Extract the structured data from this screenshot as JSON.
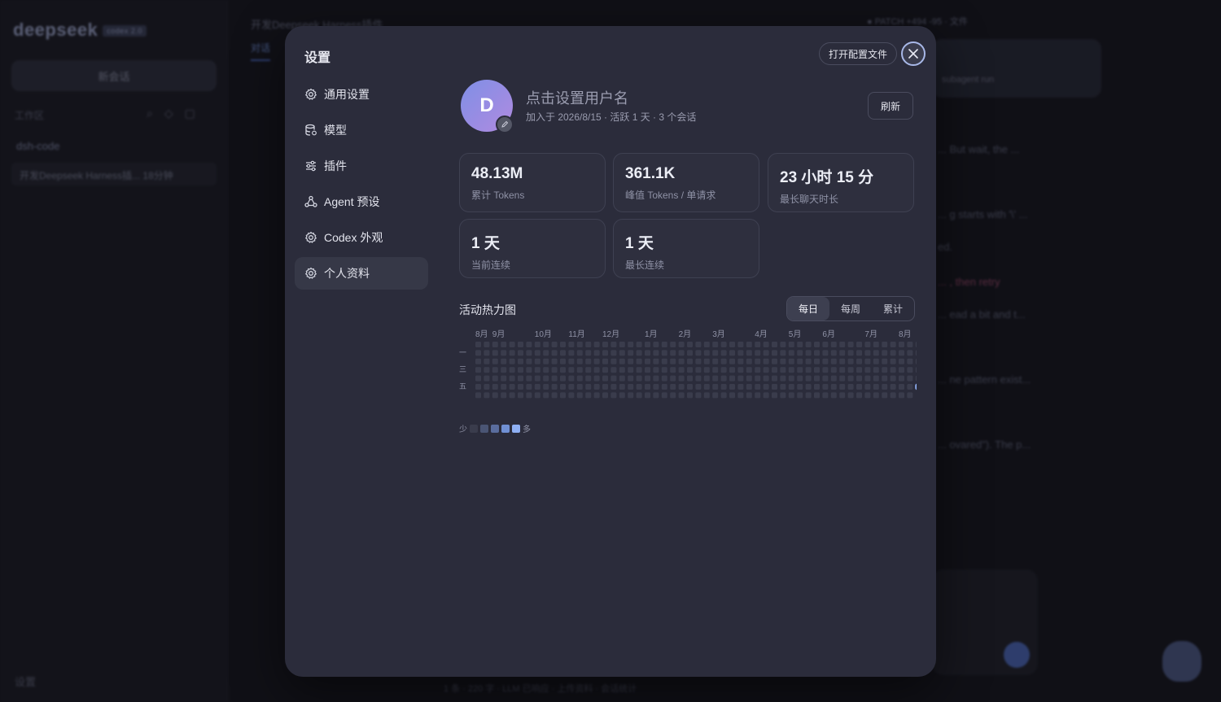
{
  "background": {
    "logo": "deepseek",
    "version": "codex 2.0",
    "new_chat": "新会话",
    "workspace_label": "工作区",
    "folder": "dsh-code",
    "session": "开发Deepseek Harness插... 18分钟",
    "settings": "设置",
    "top_title": "开发Deepseek Harness插件",
    "top_tab": "对话",
    "status": "● PATCH +494 -95 · 文件",
    "card_text": "subagent run",
    "lines": [
      "... But wait, the ...",
      "... g starts with '\\' ...",
      "ed.",
      "... , then retry",
      "... ead a bit and t...",
      "... ne pattern exist...",
      "... ovared\"). The p..."
    ],
    "bottom": "1 条 · 220 字 · LLM 已响应 · 上传资料 · 会话统计"
  },
  "modal": {
    "title": "设置",
    "open_config": "打开配置文件",
    "nav": [
      {
        "label": "通用设置",
        "icon": "gear-icon"
      },
      {
        "label": "模型",
        "icon": "database-icon"
      },
      {
        "label": "插件",
        "icon": "sliders-icon"
      },
      {
        "label": "Agent 预设",
        "icon": "agent-icon"
      },
      {
        "label": "Codex 外观",
        "icon": "gear-icon"
      },
      {
        "label": "个人资料",
        "icon": "gear-icon"
      }
    ],
    "profile": {
      "initial": "D",
      "username_placeholder": "点击设置用户名",
      "meta": "加入于 2026/8/15 · 活跃 1 天 · 3 个会话",
      "refresh": "刷新"
    },
    "stats": [
      {
        "value": "48.13M",
        "label": "累计 Tokens"
      },
      {
        "value": "361.1K",
        "label": "峰值 Tokens / 单请求"
      },
      {
        "value": "23 小时 15 分",
        "label": "最长聊天时长"
      },
      {
        "value": "1 天",
        "label": "当前连续"
      },
      {
        "value": "1 天",
        "label": "最长连续"
      }
    ],
    "heatmap": {
      "title": "活动热力图",
      "modes": [
        "每日",
        "每周",
        "累计"
      ],
      "active_mode": "每日",
      "months": [
        {
          "label": "8月",
          "week": 0
        },
        {
          "label": "9月",
          "week": 2
        },
        {
          "label": "10月",
          "week": 7
        },
        {
          "label": "11月",
          "week": 11
        },
        {
          "label": "12月",
          "week": 15
        },
        {
          "label": "1月",
          "week": 20
        },
        {
          "label": "2月",
          "week": 24
        },
        {
          "label": "3月",
          "week": 28
        },
        {
          "label": "4月",
          "week": 33
        },
        {
          "label": "5月",
          "week": 37
        },
        {
          "label": "6月",
          "week": 41
        },
        {
          "label": "7月",
          "week": 46
        },
        {
          "label": "8月",
          "week": 50
        }
      ],
      "weekday_labels": [
        {
          "label": "一",
          "row": 1
        },
        {
          "label": "三",
          "row": 3
        },
        {
          "label": "五",
          "row": 5
        }
      ],
      "weeks": 53,
      "last_week_days": 6,
      "active_cells": [
        {
          "week": 52,
          "day": 5,
          "level": 4
        }
      ],
      "legend_less": "少",
      "legend_more": "多",
      "levels": [
        "#3a3c4c",
        "#4a5574",
        "#5a6d9e",
        "#7090d4",
        "#8fb0f4"
      ]
    }
  }
}
